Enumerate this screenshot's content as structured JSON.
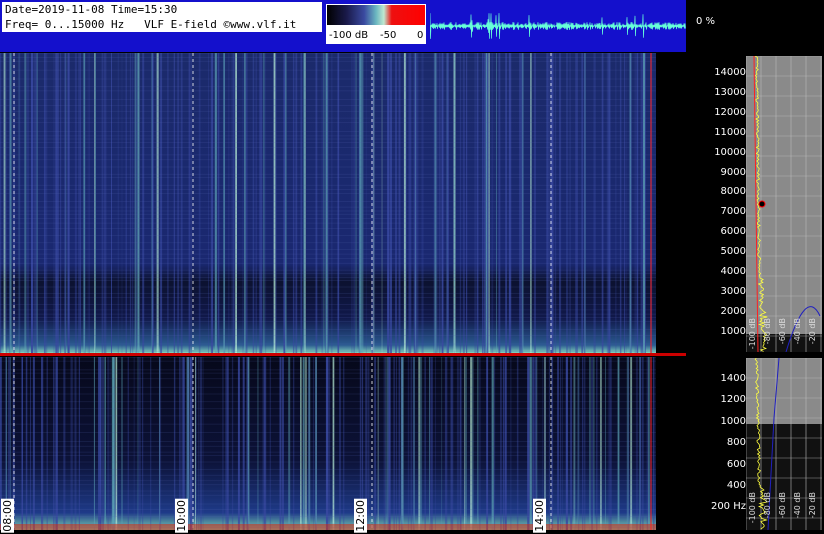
{
  "header": {
    "line1": "Date=2019-11-08 Time=15:30",
    "line2": "Freq= 0...15000 Hz   VLF E-field ©www.vlf.it",
    "percent": "0 %"
  },
  "colorbar": {
    "labels": [
      "-100 dB",
      "-50",
      "0"
    ]
  },
  "upper_axis": {
    "labels": [
      "14000",
      "13000",
      "12000",
      "11000",
      "10000",
      "9000",
      "8000",
      "7000",
      "6000",
      "5000",
      "4000",
      "3000",
      "2000",
      "1000"
    ]
  },
  "lower_axis": {
    "labels": [
      "1400",
      "1200",
      "1000",
      "800",
      "600",
      "400",
      "200 Hz"
    ]
  },
  "time_labels": [
    "08:00",
    "10:00",
    "12:00",
    "14:00"
  ],
  "db_labels": [
    "-100 dB",
    "-80 dB",
    "-60 dB",
    "-40 dB",
    "-20 dB"
  ],
  "colors": {
    "header_blue": "#1410cc",
    "spectral_bg": "#1b2a6b",
    "trace_yellow": "#ffff40",
    "trace_red": "#ff2020",
    "trace_blue": "#2020c0"
  }
}
